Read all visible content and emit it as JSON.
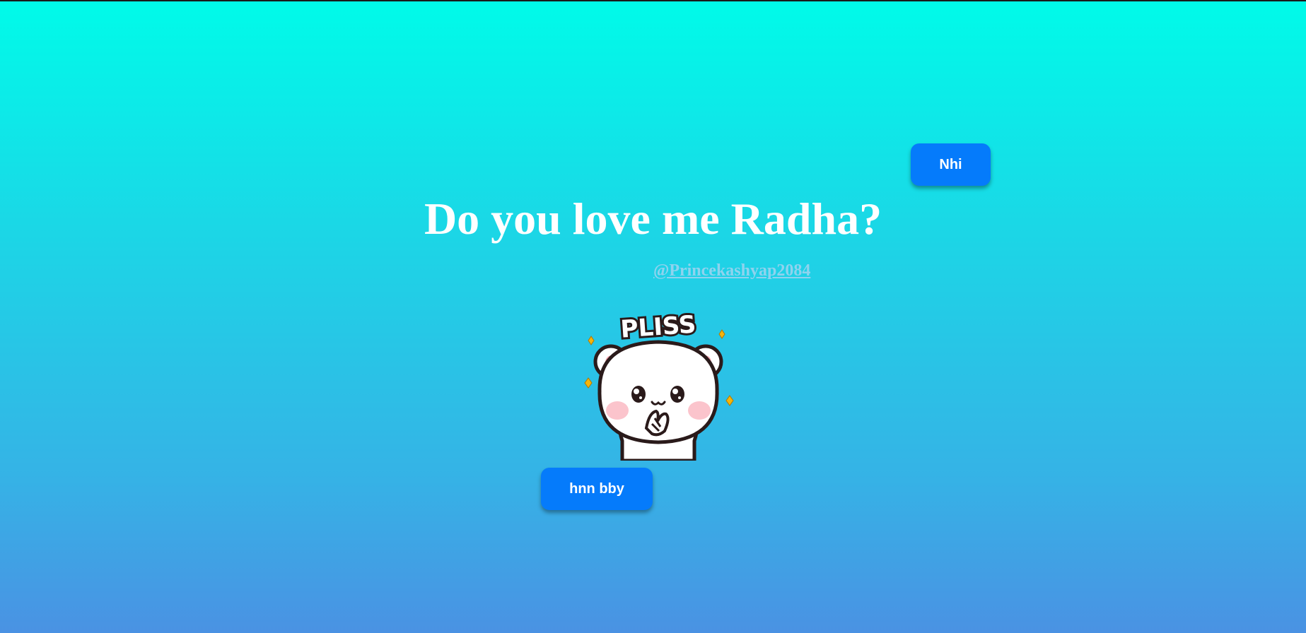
{
  "page": {
    "title": "Do you love me Radha?",
    "handle": "@Princekashyap2084"
  },
  "buttons": {
    "no_label": "Nhi",
    "yes_label": "hnn bby"
  },
  "sticker": {
    "text": "PLISS",
    "icon": "pleading-bear-icon"
  },
  "colors": {
    "gradient_top": "#00fbe9",
    "gradient_bottom": "#4a92e3",
    "button": "#057bfb",
    "handle": "#8fd3ee"
  }
}
